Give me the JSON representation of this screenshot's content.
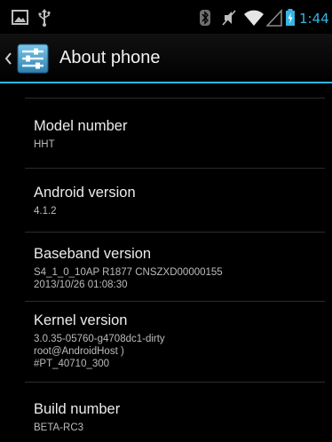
{
  "status_bar": {
    "time": "1:44",
    "icons": [
      "picture-notification-icon",
      "usb-icon",
      "bluetooth-icon",
      "vibrate-icon",
      "wifi-icon",
      "cell-signal-icon",
      "battery-charging-icon"
    ],
    "accent_color": "#33b5e5"
  },
  "action_bar": {
    "title": "About phone",
    "icon": "settings-icon"
  },
  "items": [
    {
      "title": "Model number",
      "summary": "HHT"
    },
    {
      "title": "Android version",
      "summary": "4.1.2"
    },
    {
      "title": "Baseband version",
      "summary": "S4_1_0_10AP R1877 CNSZXD00000155\n2013/10/26 01:08:30"
    },
    {
      "title": "Kernel version",
      "summary": "3.0.35-05760-g4708dc1-dirty\nroot@AndroidHost )\n#PT_40710_300"
    },
    {
      "title": "Build number",
      "summary": "BETA-RC3"
    }
  ]
}
